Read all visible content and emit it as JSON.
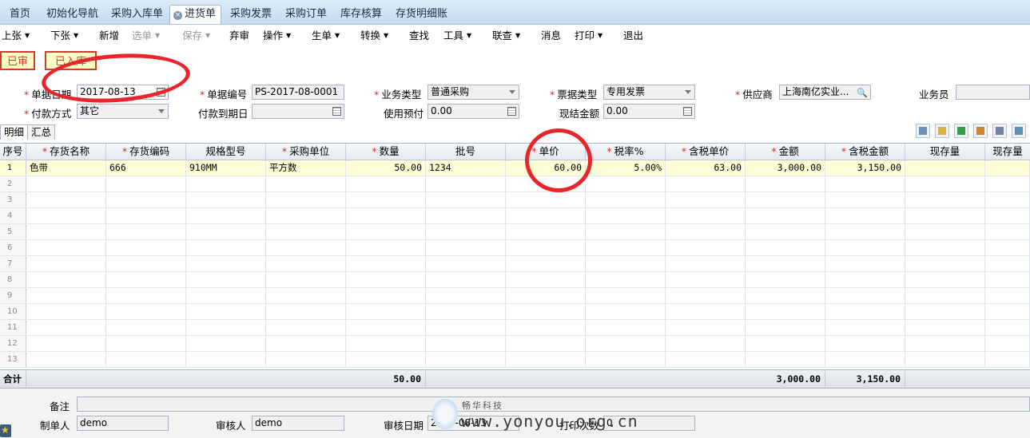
{
  "tabs": [
    "首页",
    "初始化导航",
    "采购入库单",
    "进货单",
    "采购发票",
    "采购订单",
    "库存核算",
    "存货明细账"
  ],
  "active_tab_index": 3,
  "toolbar": {
    "items": [
      {
        "label": "上张",
        "dd": true
      },
      {
        "label": "下张",
        "dd": true
      },
      {
        "label": "新增",
        "dd": false
      },
      {
        "label": "选单",
        "dd": true,
        "disabled": true
      },
      {
        "label": "保存",
        "dd": true,
        "disabled": true
      },
      {
        "label": "弃审",
        "dd": false
      },
      {
        "label": "操作",
        "dd": true
      },
      {
        "label": "生单",
        "dd": true
      },
      {
        "label": "转换",
        "dd": true
      },
      {
        "label": "查找",
        "dd": false
      },
      {
        "label": "工具",
        "dd": true
      },
      {
        "label": "联查",
        "dd": true
      },
      {
        "label": "消息",
        "dd": false
      },
      {
        "label": "打印",
        "dd": true
      },
      {
        "label": "退出",
        "dd": false
      }
    ]
  },
  "status_tags": [
    "已审",
    "已入库"
  ],
  "form": {
    "row1": [
      {
        "label": "单据日期",
        "required": true,
        "value": "2017-08-13",
        "kind": "date"
      },
      {
        "label": "单据编号",
        "required": true,
        "value": "PS-2017-08-0001",
        "kind": "text"
      },
      {
        "label": "业务类型",
        "required": true,
        "value": "普通采购",
        "kind": "select"
      },
      {
        "label": "票据类型",
        "required": true,
        "value": "专用发票",
        "kind": "select"
      },
      {
        "label": "供应商",
        "required": true,
        "value": "上海南亿实业...",
        "kind": "lookup"
      },
      {
        "label": "业务员",
        "required": false,
        "value": "",
        "kind": "text"
      }
    ],
    "row2": [
      {
        "label": "付款方式",
        "required": true,
        "value": "其它",
        "kind": "select"
      },
      {
        "label": "付款到期日",
        "required": false,
        "value": "",
        "kind": "date"
      },
      {
        "label": "使用预付",
        "required": false,
        "value": "0.00",
        "kind": "calc"
      },
      {
        "label": "现结金额",
        "required": false,
        "value": "0.00",
        "kind": "calc"
      }
    ]
  },
  "subtabs": [
    "明细",
    "汇总"
  ],
  "grid": {
    "columns": [
      {
        "label": "序号",
        "required": false
      },
      {
        "label": "存货名称",
        "required": true
      },
      {
        "label": "存货编码",
        "required": true
      },
      {
        "label": "规格型号",
        "required": false
      },
      {
        "label": "采购单位",
        "required": true
      },
      {
        "label": "数量",
        "required": true
      },
      {
        "label": "批号",
        "required": false
      },
      {
        "label": "单价",
        "required": true
      },
      {
        "label": "税率%",
        "required": true
      },
      {
        "label": "含税单价",
        "required": true
      },
      {
        "label": "金额",
        "required": true
      },
      {
        "label": "含税金额",
        "required": true
      },
      {
        "label": "现存量",
        "required": false
      },
      {
        "label": "现存量",
        "required": false
      }
    ],
    "rows": [
      [
        "色带",
        "666",
        "910MM",
        "平方数",
        "50.00",
        "1234",
        "60.00",
        "5.00%",
        "63.00",
        "3,000.00",
        "3,150.00",
        "",
        ""
      ]
    ],
    "row_numbers": [
      "1",
      "2",
      "3",
      "4",
      "5",
      "6",
      "7",
      "8",
      "9",
      "10",
      "11",
      "12",
      "13"
    ],
    "totals": {
      "label": "合计",
      "qty": "50.00",
      "amount": "3,000.00",
      "tax_amount": "3,150.00"
    }
  },
  "footer": {
    "remark_label": "备注",
    "maker_label": "制单人",
    "maker": "demo",
    "auditor_label": "审核人",
    "auditor": "demo",
    "audit_date_label": "审核日期",
    "audit_date": "2017-08-13",
    "print_count_label": "打印次数",
    "print_count": "0"
  },
  "watermark": {
    "brand": "畅华科技",
    "site": "www.yonyou.org.cn"
  }
}
